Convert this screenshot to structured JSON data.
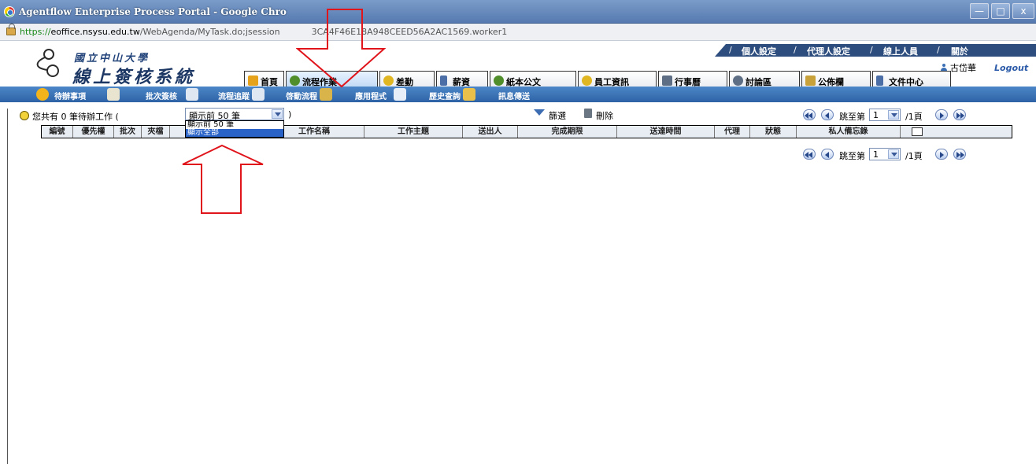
{
  "window": {
    "title": "Agentflow Enterprise Process Portal - Google Chro",
    "url_scheme": "https://",
    "url_host": "eoffice.nsysu.edu.tw",
    "url_rest": "/WebAgenda/MyTask.do;jsession",
    "url_tail": "3CA4F46E18A948CEED56A2AC1569.worker1",
    "controls": {
      "minimize": "—",
      "maximize": "□",
      "close": "x"
    }
  },
  "logo": {
    "line1": "國立中山大學",
    "line2": "線上簽核系統"
  },
  "toplinks": [
    "個人設定",
    "代理人設定",
    "線上人員",
    "關於"
  ],
  "user": {
    "name": "古岱華",
    "logout": "Logout"
  },
  "tabs": [
    {
      "label": "首頁",
      "icon": "home-icon",
      "color": "#e7a21b"
    },
    {
      "label": "流程作業",
      "icon": "gear-icon",
      "color": "#4f8e2a"
    },
    {
      "label": "差勤",
      "icon": "person-icon",
      "color": "#e0b622"
    },
    {
      "label": "薪資",
      "icon": "book-icon",
      "color": "#4c6ea7"
    },
    {
      "label": "紙本公文",
      "icon": "gear-icon",
      "color": "#4f8e2a"
    },
    {
      "label": "員工資訊",
      "icon": "person-icon",
      "color": "#e0b622"
    },
    {
      "label": "行事曆",
      "icon": "calendar-icon",
      "color": "#5e6e85"
    },
    {
      "label": "討論區",
      "icon": "chat-icon",
      "color": "#5e6e85"
    },
    {
      "label": "公佈欄",
      "icon": "board-icon",
      "color": "#c8a13a"
    },
    {
      "label": "文件中心",
      "icon": "book-icon",
      "color": "#4c6ea7"
    }
  ],
  "active_tab": "流程作業",
  "subnav": [
    {
      "label": "待辦事項",
      "icon": "gear-icon",
      "color": "#f2b31b"
    },
    {
      "label": "批次簽核",
      "icon": "stamp-icon",
      "color": "#e9e4d0"
    },
    {
      "label": "流程追蹤",
      "icon": "magnifier-icon",
      "color": "#dfe7f2"
    },
    {
      "label": "啓動流程",
      "icon": "flow-icon",
      "color": "#dfe7f2"
    },
    {
      "label": "應用程式",
      "icon": "apps-icon",
      "color": "#d8b44a"
    },
    {
      "label": "歷史查詢",
      "icon": "history-icon",
      "color": "#e8eef7"
    },
    {
      "label": "訊息傳送",
      "icon": "message-icon",
      "color": "#e8c04a"
    }
  ],
  "work": {
    "info_prefix": "您共有 0 筆待辦工作 (",
    "info_suffix": ")",
    "select_value": "顯示前 50 筆",
    "select_options": [
      "顯示前 50 筆",
      "顯示全部"
    ],
    "selected_option": "顯示全部",
    "filter_label": "篩選",
    "delete_label": "刪除"
  },
  "pager": {
    "jump_label": "跳至第",
    "page_value": "1",
    "total": "/1頁"
  },
  "table_headers": [
    "編號",
    "優先權",
    "批次",
    "夾檔",
    "",
    "工作名稱",
    "工作主題",
    "送出人",
    "完成期限",
    "送達時間",
    "代理",
    "狀態",
    "私人備忘錄"
  ]
}
